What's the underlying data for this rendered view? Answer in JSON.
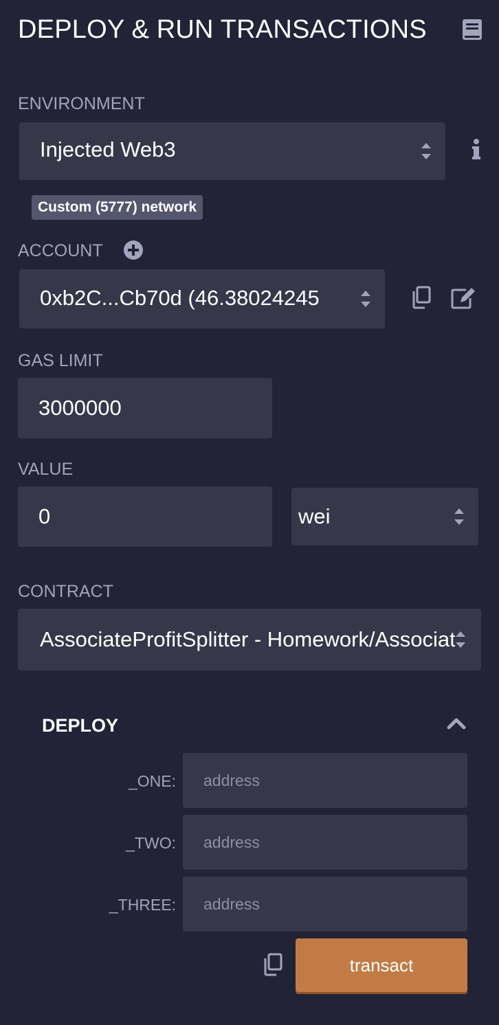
{
  "header": {
    "title": "DEPLOY & RUN TRANSACTIONS",
    "doc_icon": "book-icon"
  },
  "environment": {
    "label": "ENVIRONMENT",
    "selected": "Injected Web3",
    "network_badge": "Custom (5777) network",
    "info_icon": "info-icon"
  },
  "account": {
    "label": "ACCOUNT",
    "selected": "0xb2C...Cb70d (46.38024245",
    "add_icon": "plus-circle-icon",
    "copy_icon": "copy-icon",
    "edit_icon": "edit-icon"
  },
  "gas_limit": {
    "label": "GAS LIMIT",
    "value": "3000000"
  },
  "value": {
    "label": "VALUE",
    "amount": "0",
    "unit": "wei"
  },
  "contract": {
    "label": "CONTRACT",
    "selected": "AssociateProfitSplitter - Homework/AssociateProfitSplitter.sol"
  },
  "deploy": {
    "title": "DEPLOY",
    "collapse_icon": "chevron-up-icon",
    "params": [
      {
        "label": "_ONE:",
        "placeholder": "address"
      },
      {
        "label": "_TWO:",
        "placeholder": "address"
      },
      {
        "label": "_THREE:",
        "placeholder": "address"
      }
    ],
    "copy_icon": "copy-icon",
    "transact_label": "transact"
  },
  "colors": {
    "background": "#222336",
    "field": "#363749",
    "label": "#a2a3bd",
    "accent": "#c27b44",
    "badge": "#53566d"
  }
}
